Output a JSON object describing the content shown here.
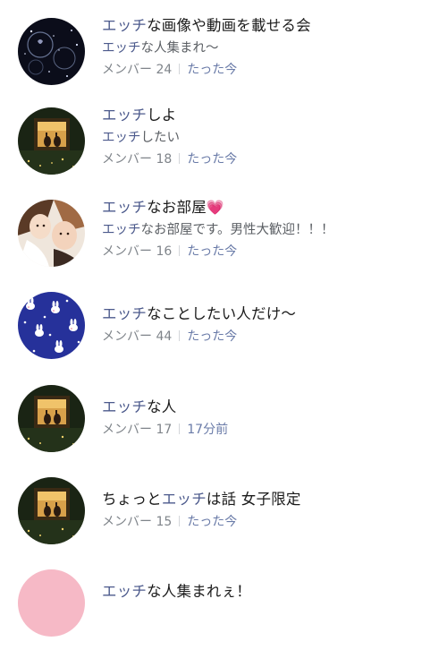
{
  "groups": [
    {
      "title_kw": "エッチ",
      "title_rest": "な画像や動画を載せる会",
      "desc_kw": "エッチ",
      "desc_rest": "な人集まれ〜",
      "members": "メンバー 24",
      "time": "たった今",
      "avatar": "stars-night-icon"
    },
    {
      "title_kw": "エッチ",
      "title_rest": "しよ",
      "desc_kw": "エッチ",
      "desc_rest": "したい",
      "members": "メンバー 18",
      "time": "たった今",
      "avatar": "bunnies-window-icon"
    },
    {
      "title_kw": "エッチ",
      "title_rest": "なお部屋",
      "title_emoji": "💗",
      "desc_kw": "エッチ",
      "desc_rest": "なお部屋です。男性大歓迎！！！",
      "members": "メンバー 16",
      "time": "たった今",
      "avatar": "anime-couple-icon"
    },
    {
      "title_kw": "エッチ",
      "title_rest": "なことしたい人だけ〜",
      "members": "メンバー 44",
      "time": "たった今",
      "avatar": "bunny-pattern-icon"
    },
    {
      "title_kw": "エッチ",
      "title_rest": "な人",
      "members": "メンバー 17",
      "time": "17分前",
      "avatar": "bunnies-window-icon"
    },
    {
      "title_pre": "ちょっと",
      "title_kw": "エッチ",
      "title_rest": "は話 女子限定",
      "members": "メンバー 15",
      "time": "たった今",
      "avatar": "bunnies-window-icon"
    },
    {
      "title_kw": "エッチ",
      "title_rest": "な人集まれぇ！",
      "avatar": "pink-circle-icon"
    }
  ],
  "colors": {
    "keyword": "#4c5a8c",
    "text": "#1a1a1a",
    "meta": "#7f848a",
    "time": "#6a7ba8"
  }
}
